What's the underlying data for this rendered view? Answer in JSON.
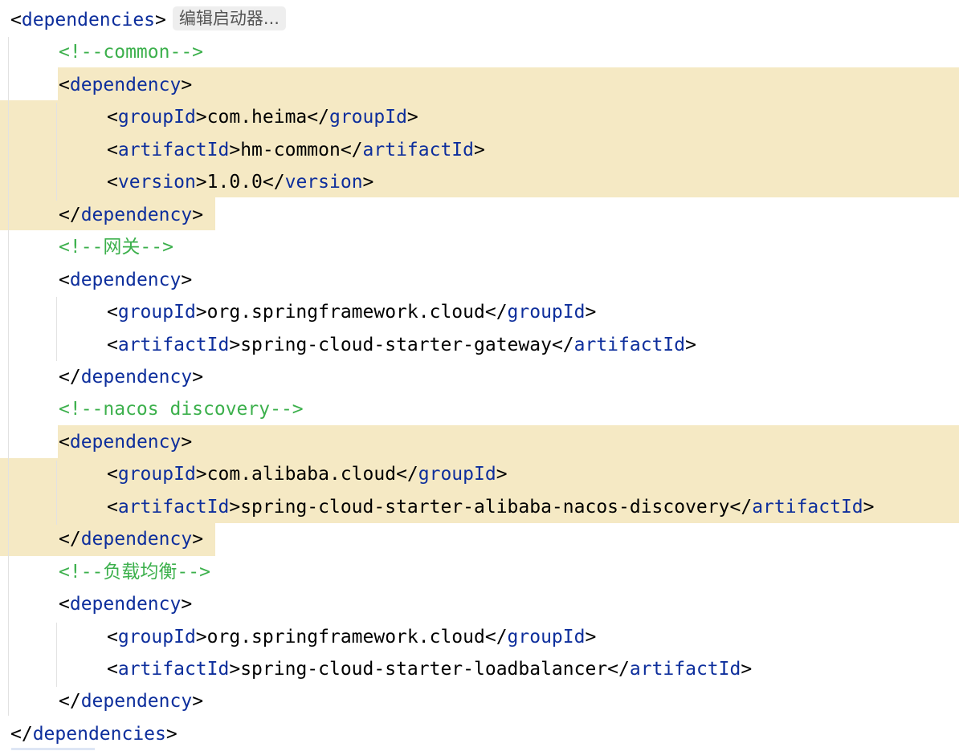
{
  "editor": {
    "inlay_hint": "编辑启动器...",
    "lines": [
      {
        "indent": 0,
        "type": "open",
        "tag": "dependencies"
      },
      {
        "indent": 1,
        "type": "comment",
        "text": "<!--common-->"
      },
      {
        "indent": 1,
        "type": "open",
        "tag": "dependency"
      },
      {
        "indent": 2,
        "type": "element",
        "tag": "groupId",
        "value": "com.heima"
      },
      {
        "indent": 2,
        "type": "element",
        "tag": "artifactId",
        "value": "hm-common"
      },
      {
        "indent": 2,
        "type": "element",
        "tag": "version",
        "value": "1.0.0"
      },
      {
        "indent": 1,
        "type": "close",
        "tag": "dependency"
      },
      {
        "indent": 1,
        "type": "comment",
        "text": "<!--网关-->"
      },
      {
        "indent": 1,
        "type": "open",
        "tag": "dependency"
      },
      {
        "indent": 2,
        "type": "element",
        "tag": "groupId",
        "value": "org.springframework.cloud"
      },
      {
        "indent": 2,
        "type": "element",
        "tag": "artifactId",
        "value": "spring-cloud-starter-gateway"
      },
      {
        "indent": 1,
        "type": "close",
        "tag": "dependency"
      },
      {
        "indent": 1,
        "type": "comment",
        "text": "<!--nacos discovery-->"
      },
      {
        "indent": 1,
        "type": "open",
        "tag": "dependency"
      },
      {
        "indent": 2,
        "type": "element",
        "tag": "groupId",
        "value": "com.alibaba.cloud"
      },
      {
        "indent": 2,
        "type": "element",
        "tag": "artifactId",
        "value": "spring-cloud-starter-alibaba-nacos-discovery"
      },
      {
        "indent": 1,
        "type": "close",
        "tag": "dependency"
      },
      {
        "indent": 1,
        "type": "comment",
        "text": "<!--负载均衡-->"
      },
      {
        "indent": 1,
        "type": "open",
        "tag": "dependency"
      },
      {
        "indent": 2,
        "type": "element",
        "tag": "groupId",
        "value": "org.springframework.cloud"
      },
      {
        "indent": 2,
        "type": "element",
        "tag": "artifactId",
        "value": "spring-cloud-starter-loadbalancer"
      },
      {
        "indent": 1,
        "type": "close",
        "tag": "dependency"
      },
      {
        "indent": 0,
        "type": "close",
        "tag": "dependencies"
      }
    ]
  }
}
